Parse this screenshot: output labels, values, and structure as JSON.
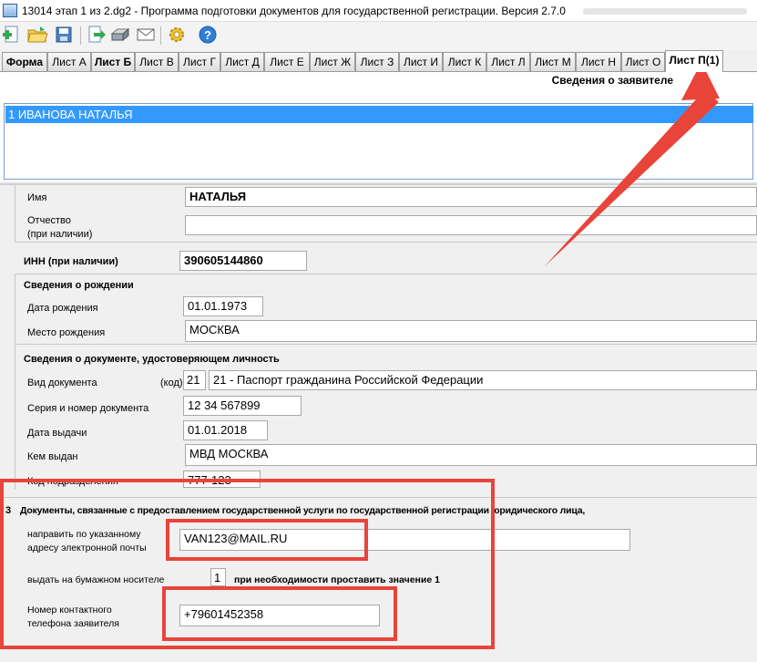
{
  "window": {
    "title": "13014 этап 1 из 2.dg2 - Программа подготовки документов для государственной регистрации. Версия 2.7.0"
  },
  "toolbar": {
    "icons": [
      "new-doc-icon",
      "open-folder-icon",
      "save-icon",
      "export-icon",
      "print-icon",
      "mail-icon",
      "settings-icon",
      "help-icon"
    ]
  },
  "tabs": [
    "Форма",
    "Лист А",
    "Лист Б",
    "Лист В",
    "Лист Г",
    "Лист Д",
    "Лист Е",
    "Лист Ж",
    "Лист З",
    "Лист И",
    "Лист К",
    "Лист Л",
    "Лист М",
    "Лист Н",
    "Лист О",
    "Лист П(1)"
  ],
  "active_tab": "Лист П(1)",
  "section": {
    "title": "Сведения о заявителе"
  },
  "applicants": [
    "1 ИВАНОВА НАТАЛЬЯ"
  ],
  "form": {
    "name_label": "Имя",
    "name_value": "НАТАЛЬЯ",
    "patronymic_label_1": "Отчество",
    "patronymic_label_2": "(при наличии)",
    "patronymic_value": "",
    "inn_label": "ИНН (при наличии)",
    "inn_value": "390605144860",
    "birth_heading": "Сведения о рождении",
    "birth_date_label": "Дата рождения",
    "birth_date_value": "01.01.1973",
    "birth_place_label": "Место рождения",
    "birth_place_value": "МОСКВА",
    "doc_heading": "Сведения о документе, удостоверяющем личность",
    "doc_type_label": "Вид документа",
    "doc_code_label": "(код)",
    "doc_code_value": "21",
    "doc_type_value": "21 - Паспорт гражданина Российской Федерации",
    "doc_number_label": "Серия и номер документа",
    "doc_number_value": "12 34 567899",
    "issue_date_label": "Дата выдачи",
    "issue_date_value": "01.01.2018",
    "issued_by_label": "Кем выдан",
    "issued_by_value": "МВД МОСКВА",
    "dept_code_label": "Код подразделения",
    "dept_code_value": "777-123"
  },
  "section3": {
    "number": "3",
    "heading": "Документы, связанные с предоставлением государственной услуги по государственной регистрации юридического лица,",
    "email_label_1": "направить по указанному",
    "email_label_2": "адресу электронной почты",
    "email_value": "VAN123@MAIL.RU",
    "paper_label": "выдать на бумажном носителе",
    "paper_value": "1",
    "paper_hint": "при необходимости проставить значение 1",
    "phone_label_1": "Номер контактного",
    "phone_label_2": "телефона заявителя",
    "phone_value": "+79601452358"
  },
  "annotation_color": "#e8443a"
}
